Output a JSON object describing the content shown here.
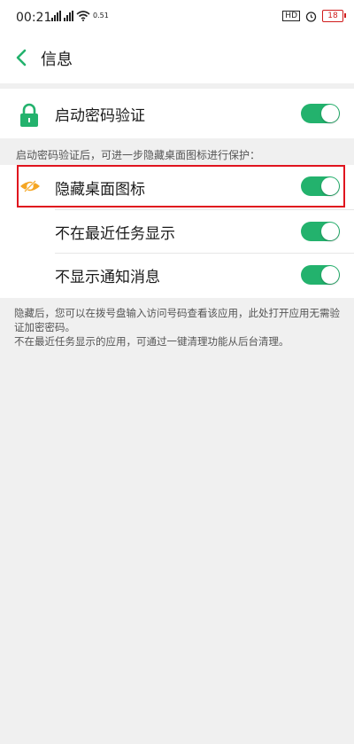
{
  "status_bar": {
    "time": "00:21",
    "network_signal_label": "4G",
    "wifi_speed": "0.51",
    "wifi_speed_unit": "KB/S",
    "hd_label": "HD",
    "battery_level": "18"
  },
  "header": {
    "back_icon": "chevron-left-icon",
    "title": "信息"
  },
  "password_row": {
    "icon": "lock-icon",
    "label": "启动密码验证",
    "enabled": true
  },
  "description": "启动密码验证后，可进一步隐藏桌面图标进行保护：",
  "options": [
    {
      "icon": "eye-off-icon",
      "label": "隐藏桌面图标",
      "enabled": true,
      "highlighted": true
    },
    {
      "icon": "",
      "label": "不在最近任务显示",
      "enabled": true,
      "highlighted": false
    },
    {
      "icon": "",
      "label": "不显示通知消息",
      "enabled": true,
      "highlighted": false
    }
  ],
  "footer": {
    "line1": "隐藏后，您可以在拨号盘输入访问号码查看该应用，此处打开应用无需验证加密密码。",
    "line2": "不在最近任务显示的应用，可通过一键清理功能从后台清理。"
  },
  "colors": {
    "accent_green": "#23b26d",
    "highlight_red": "#e0141e",
    "hide_icon_orange": "#f5a623",
    "battery_red": "#d01b1b"
  }
}
